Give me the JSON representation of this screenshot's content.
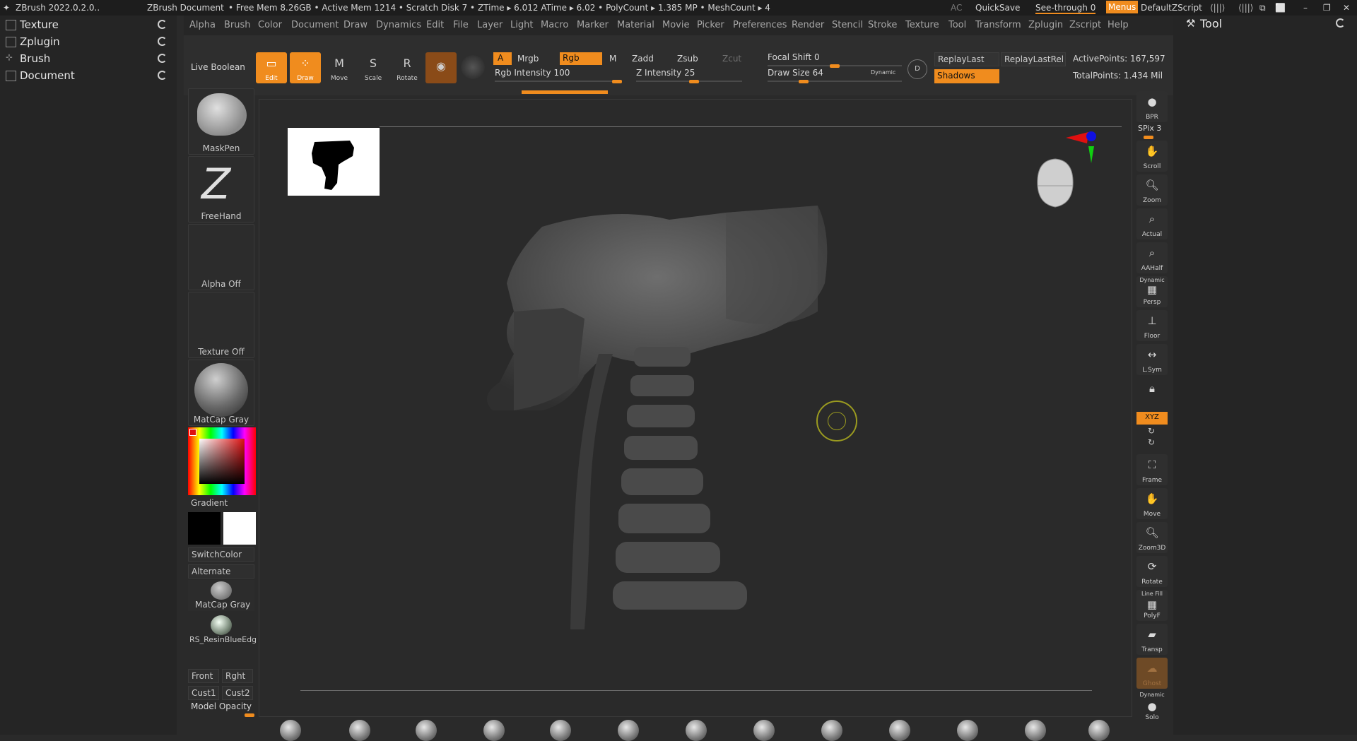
{
  "titlebar": {
    "app_name": "ZBrush 2022.0.2.0..",
    "document": "ZBrush Document",
    "stats": "• Free Mem 8.26GB • Active Mem 1214 • Scratch Disk 7 • ZTime ▸ 6.012 ATime ▸ 6.02 • PolyCount ▸ 1.385 MP  • MeshCount ▸ 4",
    "ac": "AC",
    "quicksave": "QuickSave",
    "see_through_label": "See-through",
    "see_through_value": "0",
    "menus": "Menus",
    "script": "DefaultZScript"
  },
  "menubar": [
    "Alpha",
    "Brush",
    "Color",
    "Document",
    "Draw",
    "Dynamics",
    "Edit",
    "File",
    "Layer",
    "Light",
    "Macro",
    "Marker",
    "Material",
    "Movie",
    "Picker",
    "Preferences",
    "Render",
    "Stencil",
    "Stroke",
    "Texture",
    "Tool",
    "Transform",
    "Zplugin",
    "Zscript",
    "Help"
  ],
  "left_tray": {
    "items": [
      "Texture",
      "Zplugin",
      "Brush",
      "Document"
    ]
  },
  "right_tray": {
    "title": "Tool"
  },
  "shelf": {
    "live_boolean": "Live Boolean",
    "buttons": {
      "edit": "Edit",
      "draw": "Draw",
      "move": "Move",
      "scale": "Scale",
      "rotate": "Rotate"
    },
    "a": "A",
    "mrgb": "Mrgb",
    "rgb": "Rgb",
    "m": "M",
    "zadd": "Zadd",
    "zsub": "Zsub",
    "zcut": "Zcut",
    "rgb_intensity_label": "Rgb Intensity",
    "rgb_intensity": "100",
    "z_intensity_label": "Z Intensity",
    "z_intensity": "25",
    "focal_shift_label": "Focal Shift",
    "focal_shift": "0",
    "draw_size_label": "Draw Size",
    "draw_size": "64",
    "dynamic": "Dynamic",
    "replay_last": "ReplayLast",
    "replay_last_rel": "ReplayLastRel",
    "shadows": "Shadows",
    "active_points": "ActivePoints: 167,597",
    "total_points": "TotalPoints: 1.434 Mil"
  },
  "left_panel": {
    "brush": "MaskPen",
    "stroke": "FreeHand",
    "alpha": "Alpha Off",
    "texture": "Texture Off",
    "material": "MatCap Gray",
    "gradient": "Gradient",
    "switch_color": "SwitchColor",
    "alternate": "Alternate",
    "material2": "MatCap Gray",
    "material3": "RS_ResinBlueEdge",
    "front": "Front",
    "right": "Rght",
    "cust1": "Cust1",
    "cust2": "Cust2",
    "model_opacity": "Model Opacity"
  },
  "right_dock": {
    "bpr": "BPR",
    "spix": "SPix 3",
    "scroll": "Scroll",
    "zoom": "Zoom",
    "actual": "Actual",
    "aahalf": "AAHalf",
    "persp_dynamic": "Dynamic",
    "persp": "Persp",
    "floor": "Floor",
    "lsym": "L.Sym",
    "xyz": "XYZ",
    "frame": "Frame",
    "move": "Move",
    "zoom3d": "Zoom3D",
    "rotate": "Rotate",
    "linefill": "Line Fill",
    "polyf": "PolyF",
    "transp": "Transp",
    "ghost": "Ghost",
    "solo_dynamic": "Dynamic",
    "solo": "Solo"
  },
  "colors": {
    "accent": "#f08c1e",
    "background": "#2a2a2a",
    "panel": "#252525"
  }
}
